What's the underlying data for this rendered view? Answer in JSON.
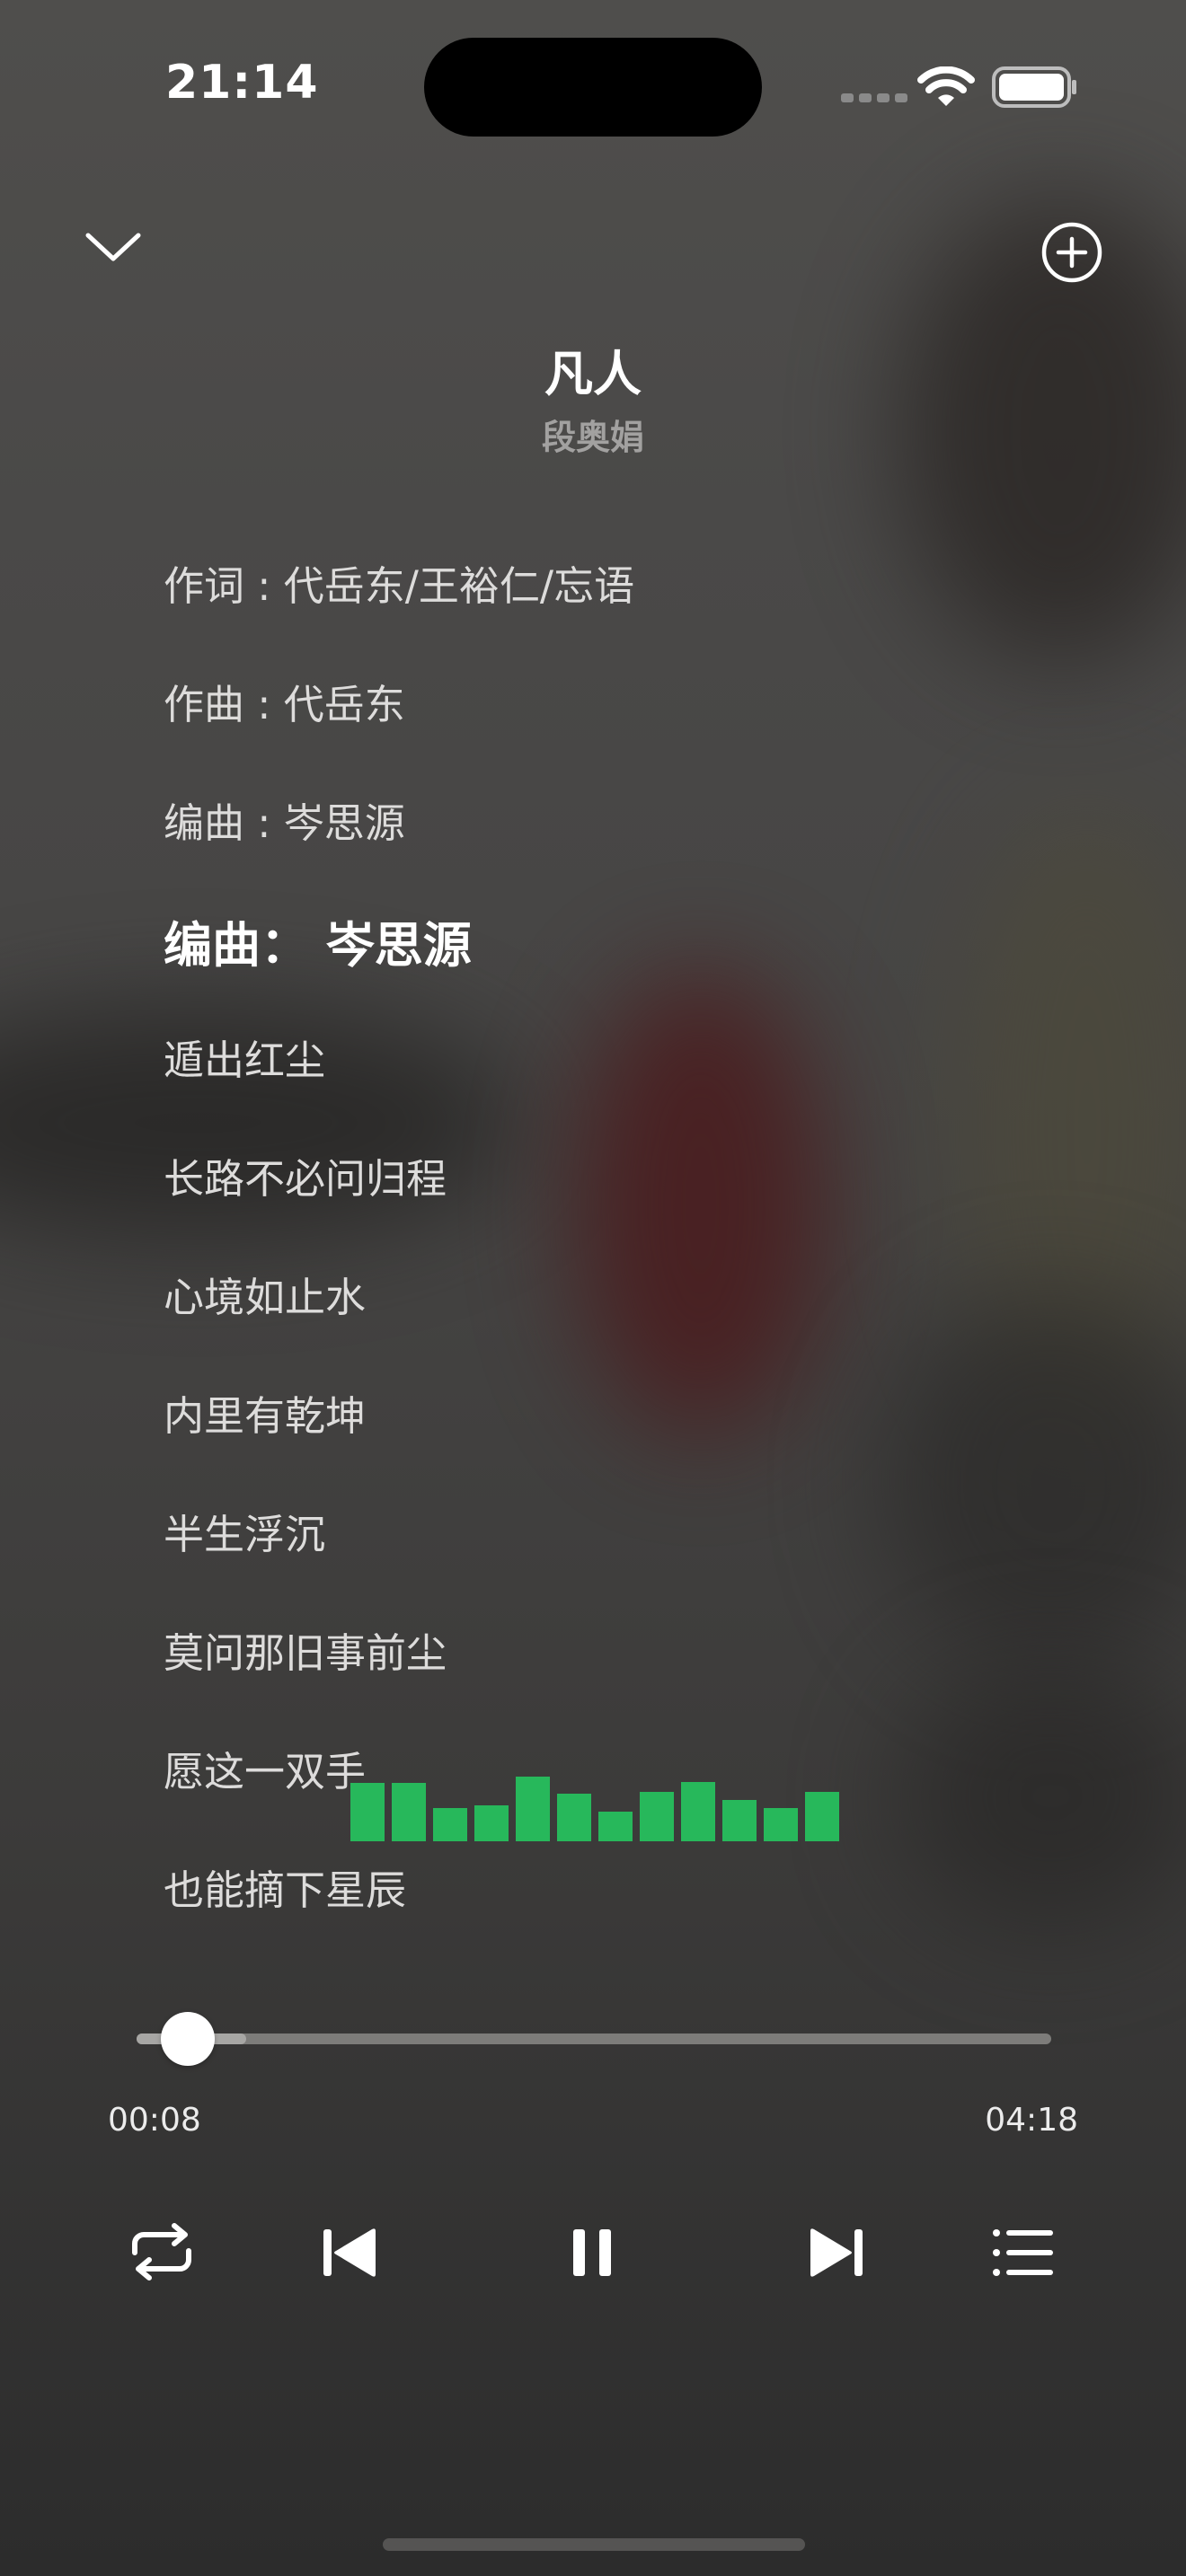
{
  "status_bar": {
    "time": "21:14"
  },
  "header": {
    "collapse_icon": "chevron-down-icon",
    "add_icon": "plus-circle-icon"
  },
  "song": {
    "title": "凡人",
    "artist": "段奥娟"
  },
  "lyrics": [
    "作词 : 代岳东/王裕仁/忘语",
    "作曲 : 代岳东",
    "编曲 : 岑思源",
    "编曲： 岑思源",
    "遁出红尘",
    "长路不必问归程",
    "心境如止水",
    "内里有乾坤",
    "半生浮沉",
    "莫问那旧事前尘",
    "愿这一双手",
    "也能摘下星辰"
  ],
  "active_lyric_index": 3,
  "equalizer": {
    "color": "#27b85b",
    "levels": [
      0.47,
      0.47,
      0.27,
      0.29,
      0.52,
      0.38,
      0.24,
      0.4,
      0.48,
      0.33,
      0.27,
      0.4
    ]
  },
  "playback": {
    "current_time": "00:08",
    "total_time": "04:18",
    "progress": 0.03
  },
  "controls": [
    "repeat-icon",
    "previous-icon",
    "pause-icon",
    "next-icon",
    "playlist-icon"
  ]
}
